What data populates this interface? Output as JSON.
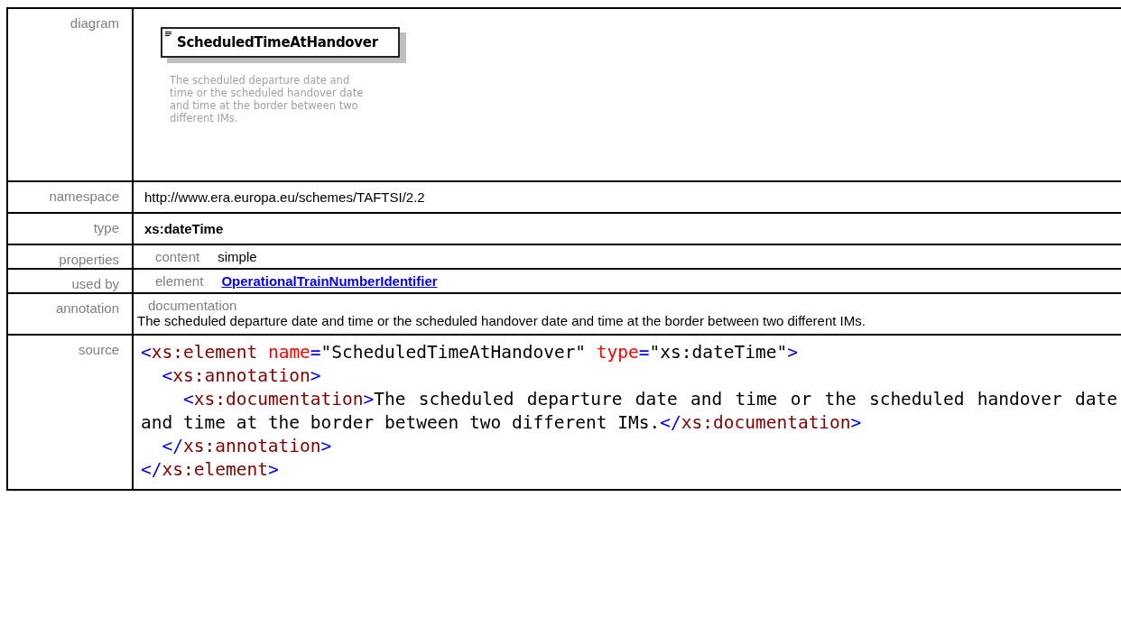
{
  "rows": [
    {
      "kind": "diagram",
      "label": "diagram",
      "element": {
        "name": "ScheduledTimeAtHandover",
        "description": "The scheduled departure date and time or the scheduled handover date and time at the border between two different IMs."
      }
    },
    {
      "kind": "text",
      "label": "namespace",
      "value": "http://www.era.europa.eu/schemes/TAFTSI/2.2"
    },
    {
      "kind": "bold",
      "label": "type",
      "value": "xs:dateTime"
    },
    {
      "kind": "pair",
      "label": "properties",
      "key": "content",
      "value": "simple"
    },
    {
      "kind": "link",
      "label": "used by",
      "key": "element",
      "value": "OperationalTrainNumberIdentifier"
    },
    {
      "kind": "doc",
      "label": "annotation",
      "key": "documentation",
      "value": "The scheduled departure date and time or the scheduled handover date and time at the border between two different IMs."
    },
    {
      "kind": "source",
      "label": "source",
      "code": {
        "open": [
          {
            "kind": "punct",
            "text": "<"
          },
          {
            "kind": "tag",
            "text": "xs:element"
          },
          {
            "kind": "attr",
            "text": " name"
          },
          {
            "kind": "punct",
            "text": "="
          },
          {
            "kind": "value",
            "text": "\"ScheduledTimeAtHandover\""
          },
          {
            "kind": "attr",
            "text": " type"
          },
          {
            "kind": "punct",
            "text": "="
          },
          {
            "kind": "value",
            "text": "\"xs:dateTime\""
          },
          {
            "kind": "punct",
            "text": ">"
          }
        ],
        "children": [
          {
            "open": [
              {
                "kind": "punct",
                "text": "<"
              },
              {
                "kind": "tag",
                "text": "xs:annotation"
              },
              {
                "kind": "punct",
                "text": ">"
              }
            ],
            "children": [
              {
                "open": [
                  {
                    "kind": "punct",
                    "text": "<"
                  },
                  {
                    "kind": "tag",
                    "text": "xs:documentation"
                  },
                  {
                    "kind": "punct",
                    "text": ">"
                  },
                  {
                    "kind": "text",
                    "text": "The scheduled departure date and time or the scheduled handover date and time at the border between two different IMs."
                  },
                  {
                    "kind": "punct",
                    "text": "</"
                  },
                  {
                    "kind": "tag",
                    "text": "xs:documentation"
                  },
                  {
                    "kind": "punct",
                    "text": ">"
                  }
                ]
              }
            ],
            "close": [
              {
                "kind": "punct",
                "text": "</"
              },
              {
                "kind": "tag",
                "text": "xs:annotation"
              },
              {
                "kind": "punct",
                "text": ">"
              }
            ]
          }
        ],
        "close": [
          {
            "kind": "punct",
            "text": "</"
          },
          {
            "kind": "tag",
            "text": "xs:element"
          },
          {
            "kind": "punct",
            "text": ">"
          }
        ]
      }
    }
  ]
}
